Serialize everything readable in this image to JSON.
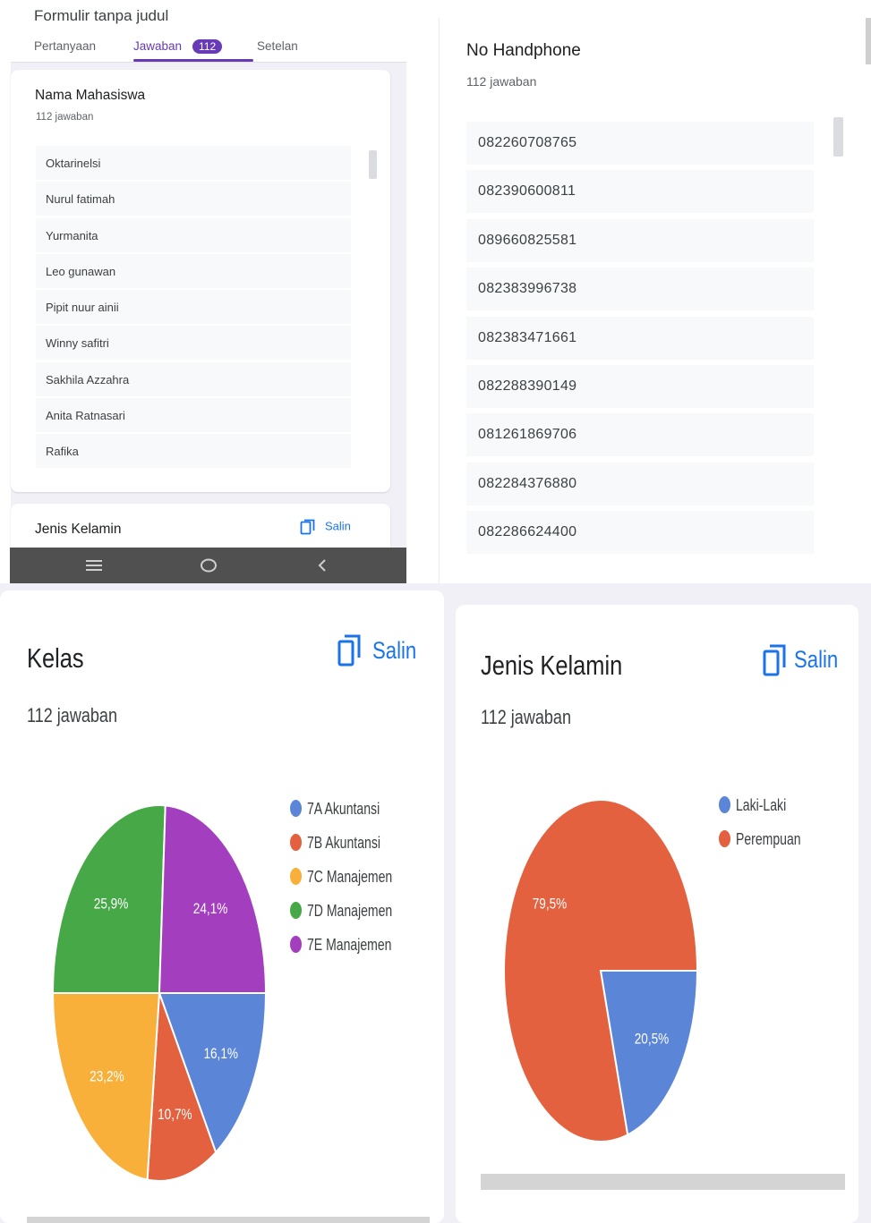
{
  "form": {
    "title": "Formulir tanpa judul",
    "tabs": [
      {
        "label": "Pertanyaan"
      },
      {
        "label": "Jawaban",
        "badge": "112"
      },
      {
        "label": "Setelan"
      }
    ]
  },
  "names_card": {
    "title": "Nama Mahasiswa",
    "count": "112 jawaban",
    "items": [
      "Oktarinelsi",
      "Nurul fatimah",
      "Yurmanita",
      "Leo gunawan",
      "Pipit nuur ainii",
      "Winny safitri",
      "Sakhila Azzahra",
      "Anita Ratnasari",
      "Rafika"
    ]
  },
  "gender_collapsed": {
    "title": "Jenis Kelamin",
    "copy_label": "Salin"
  },
  "phone_card": {
    "title": "No Handphone",
    "count": "112 jawaban",
    "items": [
      "082260708765",
      "082390600811",
      "089660825581",
      "082383996738",
      "082383471661",
      "082288390149",
      "081261869706",
      "082284376880",
      "082286624400"
    ]
  },
  "kelas_card": {
    "title": "Kelas",
    "count": "112 jawaban",
    "copy_label": "Salin"
  },
  "gender_card": {
    "title": "Jenis Kelamin",
    "count": "112 jawaban",
    "copy_label": "Salin"
  },
  "colors": {
    "blue": "#5b86d8",
    "red": "#e4613f",
    "yellow": "#f8b03b",
    "green": "#46a846",
    "purple": "#a33fbf",
    "accent": "#673ab7",
    "link": "#1a73e8"
  },
  "chart_data": [
    {
      "type": "pie",
      "categories": [
        "7A Akuntansi",
        "7B Akuntansi",
        "7C Manajemen",
        "7D Manajemen",
        "7E Manajemen"
      ],
      "values": [
        16.1,
        10.7,
        23.2,
        25.9,
        24.1
      ],
      "labels": [
        "16,1%",
        "10,7%",
        "23,2%",
        "25,9%",
        "24,1%"
      ],
      "colors": [
        "#5b86d8",
        "#e4613f",
        "#f8b03b",
        "#46a846",
        "#a33fbf"
      ],
      "legend": "right"
    },
    {
      "type": "pie",
      "categories": [
        "Laki-Laki",
        "Perempuan"
      ],
      "values": [
        20.5,
        79.5
      ],
      "labels": [
        "20,5%",
        "79,5%"
      ],
      "colors": [
        "#5b86d8",
        "#e4613f"
      ],
      "legend": "top-right"
    }
  ]
}
